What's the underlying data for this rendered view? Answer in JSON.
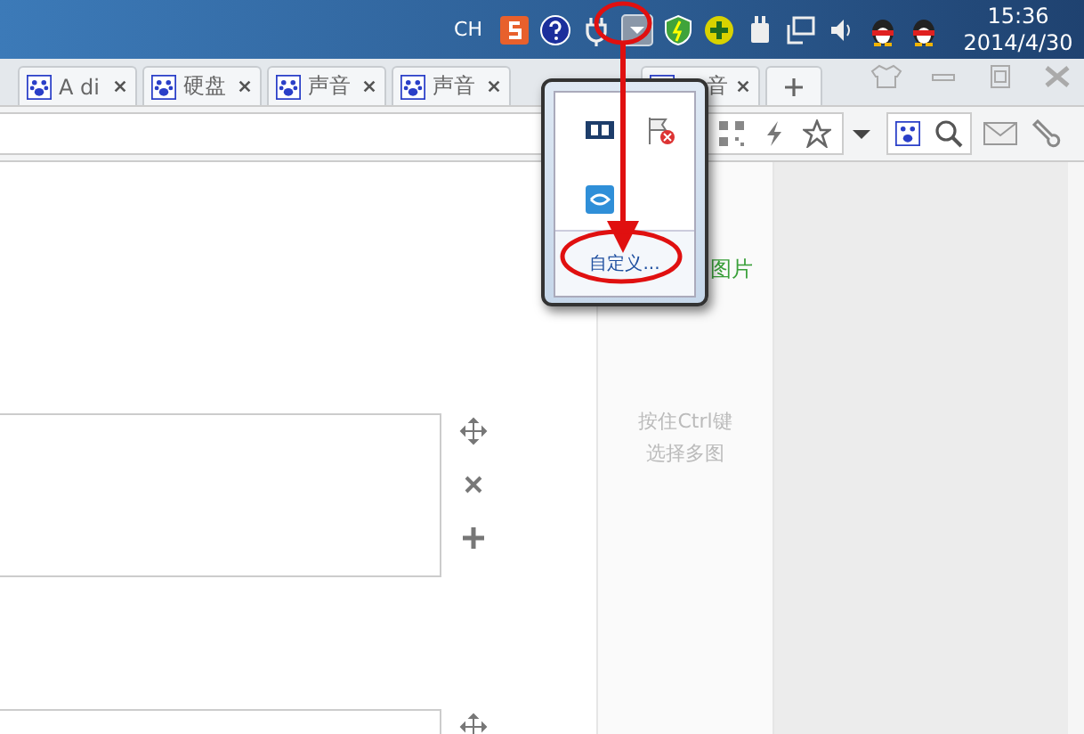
{
  "taskbar": {
    "language": "CH",
    "time": "15:36",
    "date": "2014/4/30"
  },
  "tabs": [
    {
      "label": "A di",
      "selected": false
    },
    {
      "label": "硬盘",
      "selected": false
    },
    {
      "label": "声音",
      "selected": false
    },
    {
      "label": "声音",
      "selected": false
    },
    {
      "label": "音",
      "selected": false
    }
  ],
  "tray_popup": {
    "link": "自定义..."
  },
  "upload_panel": {
    "label": "图片",
    "hint_lines": [
      "按住Ctrl键",
      "选择多图"
    ]
  }
}
